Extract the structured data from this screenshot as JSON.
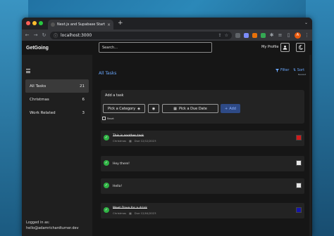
{
  "browser": {
    "tab_title": "Next.js and Supabase Starter",
    "tab_close": "×",
    "new_tab": "+",
    "tabstrip_chevron": "⌄",
    "url": "localhost:3000",
    "profile_initial": "A",
    "extension_colors": [
      "#5f6368",
      "#7c8cf8",
      "#e8710a",
      "#34a853",
      "#9aa0a6",
      "#9aa0a6"
    ]
  },
  "header": {
    "brand": "GetGoing",
    "search_placeholder": "Search...",
    "my_profile": "My Profile"
  },
  "sidebar": {
    "items": [
      {
        "label": "All Tasks",
        "count": "21",
        "active": true
      },
      {
        "label": "Christmas",
        "count": "6",
        "active": false
      },
      {
        "label": "Work Related",
        "count": "3",
        "active": false
      }
    ],
    "footer_label": "Logged in as:",
    "footer_email": "hello@adamrichardturner.dev"
  },
  "main": {
    "title": "All Tasks",
    "filter_label": "Filter",
    "sort_label": "Sort",
    "sort_sub": "Newest",
    "add_task_label": "Add a task",
    "category_button": "Pick a Category",
    "due_date_button": "Pick a Due Date",
    "add_button": "Add",
    "reset_label": "Reset"
  },
  "tasks": [
    {
      "title": "This is another task",
      "done": true,
      "category": "Christmas",
      "due": "Due 12/12/2023",
      "color": "#d11a1a"
    },
    {
      "title": "Hey there!",
      "done": false,
      "category": "",
      "due": "",
      "color": "#e6e6e6"
    },
    {
      "title": "Hello!",
      "done": false,
      "category": "",
      "due": "",
      "color": "#e6e6e6"
    },
    {
      "title": "Meet Dave for a drink",
      "done": true,
      "category": "Christmas",
      "due": "Due 12/04/2023",
      "color": "#1414a8"
    }
  ],
  "colors": {
    "accent": "#6aa8ff",
    "check": "#2fb344",
    "add_bg": "#2e4a86"
  }
}
